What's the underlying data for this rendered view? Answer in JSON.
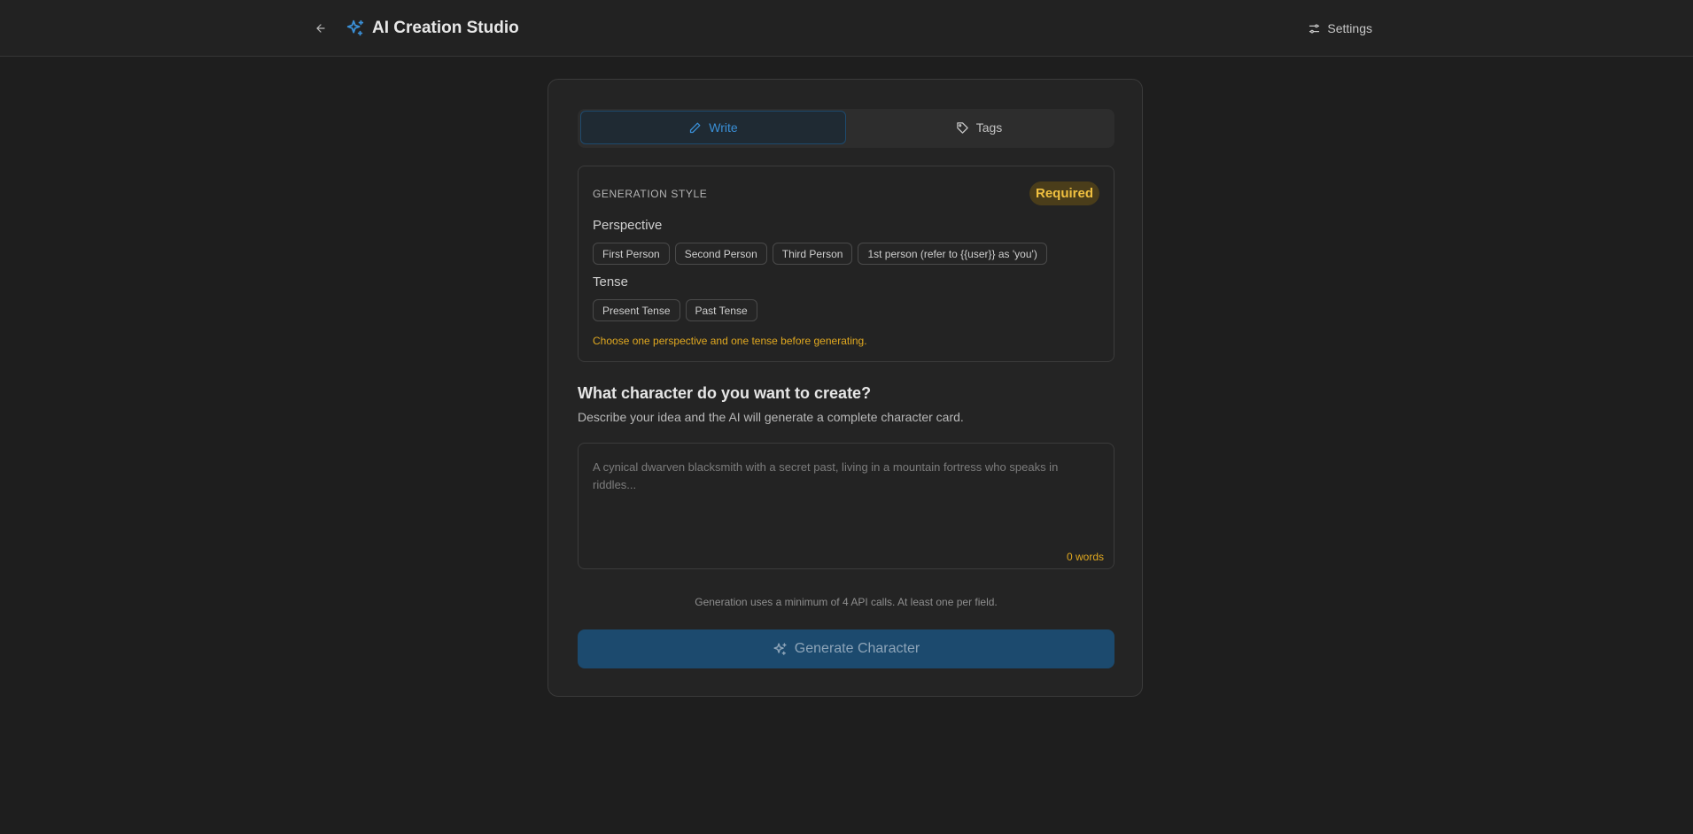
{
  "header": {
    "title": "AI Creation Studio",
    "settings_label": "Settings",
    "accent_color": "#3a8fd6"
  },
  "tabs": [
    {
      "label": "Write",
      "icon": "pencil-icon",
      "active": true
    },
    {
      "label": "Tags",
      "icon": "tag-icon",
      "active": false
    }
  ],
  "generation_style": {
    "label": "GENERATION STYLE",
    "badge": "Required",
    "perspective": {
      "title": "Perspective",
      "options": [
        "First Person",
        "Second Person",
        "Third Person",
        "1st person (refer to {{user}} as 'you')"
      ]
    },
    "tense": {
      "title": "Tense",
      "options": [
        "Present Tense",
        "Past Tense"
      ]
    },
    "hint": "Choose one perspective and one tense before generating."
  },
  "prompt": {
    "heading": "What character do you want to create?",
    "subtext": "Describe your idea and the AI will generate a complete character card.",
    "placeholder": "A cynical dwarven blacksmith with a secret past, living in a mountain fortress who speaks in riddles...",
    "value": "",
    "word_count": "0 words"
  },
  "footer": {
    "note": "Generation uses a minimum of 4 API calls. At least one per field.",
    "generate_label": "Generate Character"
  }
}
